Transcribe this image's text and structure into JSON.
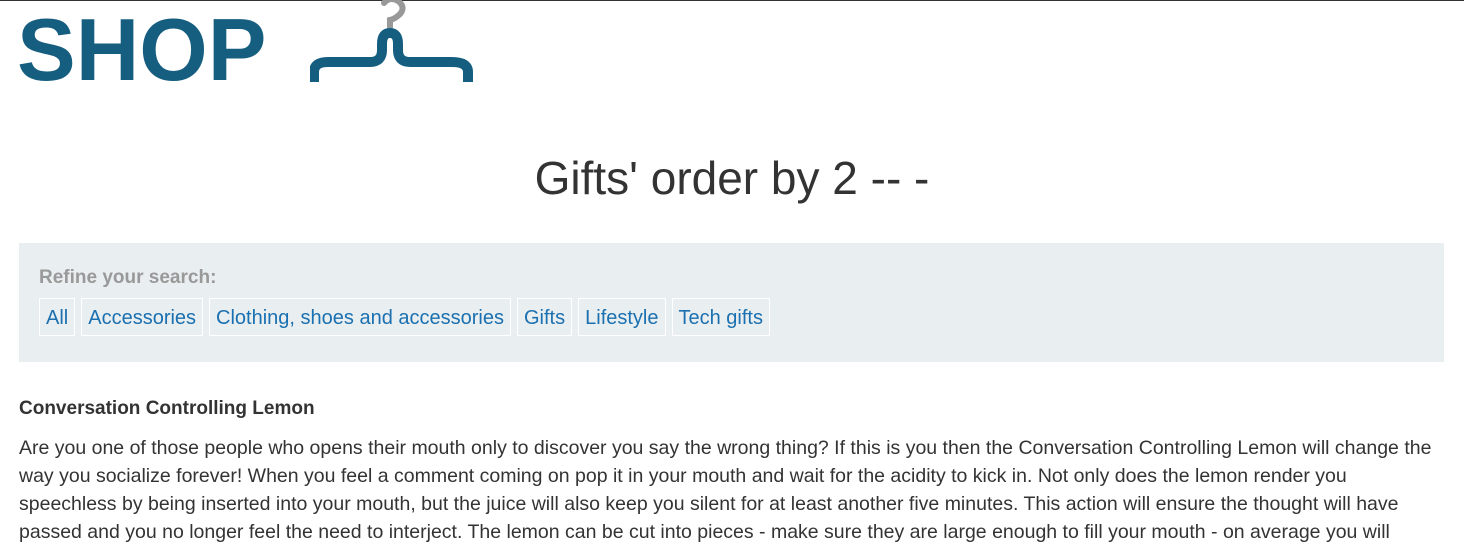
{
  "logo": {
    "text": "SHOP",
    "icon": "hanger-icon",
    "brand_color": "#165e80"
  },
  "page": {
    "title": "Gifts' order by 2 -- -"
  },
  "filters": {
    "heading": "Refine your search:",
    "items": [
      {
        "label": "All"
      },
      {
        "label": "Accessories"
      },
      {
        "label": "Clothing, shoes and accessories"
      },
      {
        "label": "Gifts"
      },
      {
        "label": "Lifestyle"
      },
      {
        "label": "Tech gifts"
      }
    ],
    "link_color": "#1a70b0",
    "panel_color": "#e9eef0"
  },
  "products": [
    {
      "name": "Conversation Controlling Lemon",
      "description": "Are you one of those people who opens their mouth only to discover you say the wrong thing? If this is you then the Conversation Controlling Lemon will change the way you socialize forever! When you feel a comment coming on pop it in your mouth and wait for the acidity to kick in. Not only does the lemon render you speechless by being inserted into your mouth, but the juice will also keep you silent for at least another five minutes. This action will ensure the thought will have passed and you no longer feel the need to interject. The lemon can be cut into pieces - make sure they are large enough to fill your mouth - on average you will"
    }
  ]
}
